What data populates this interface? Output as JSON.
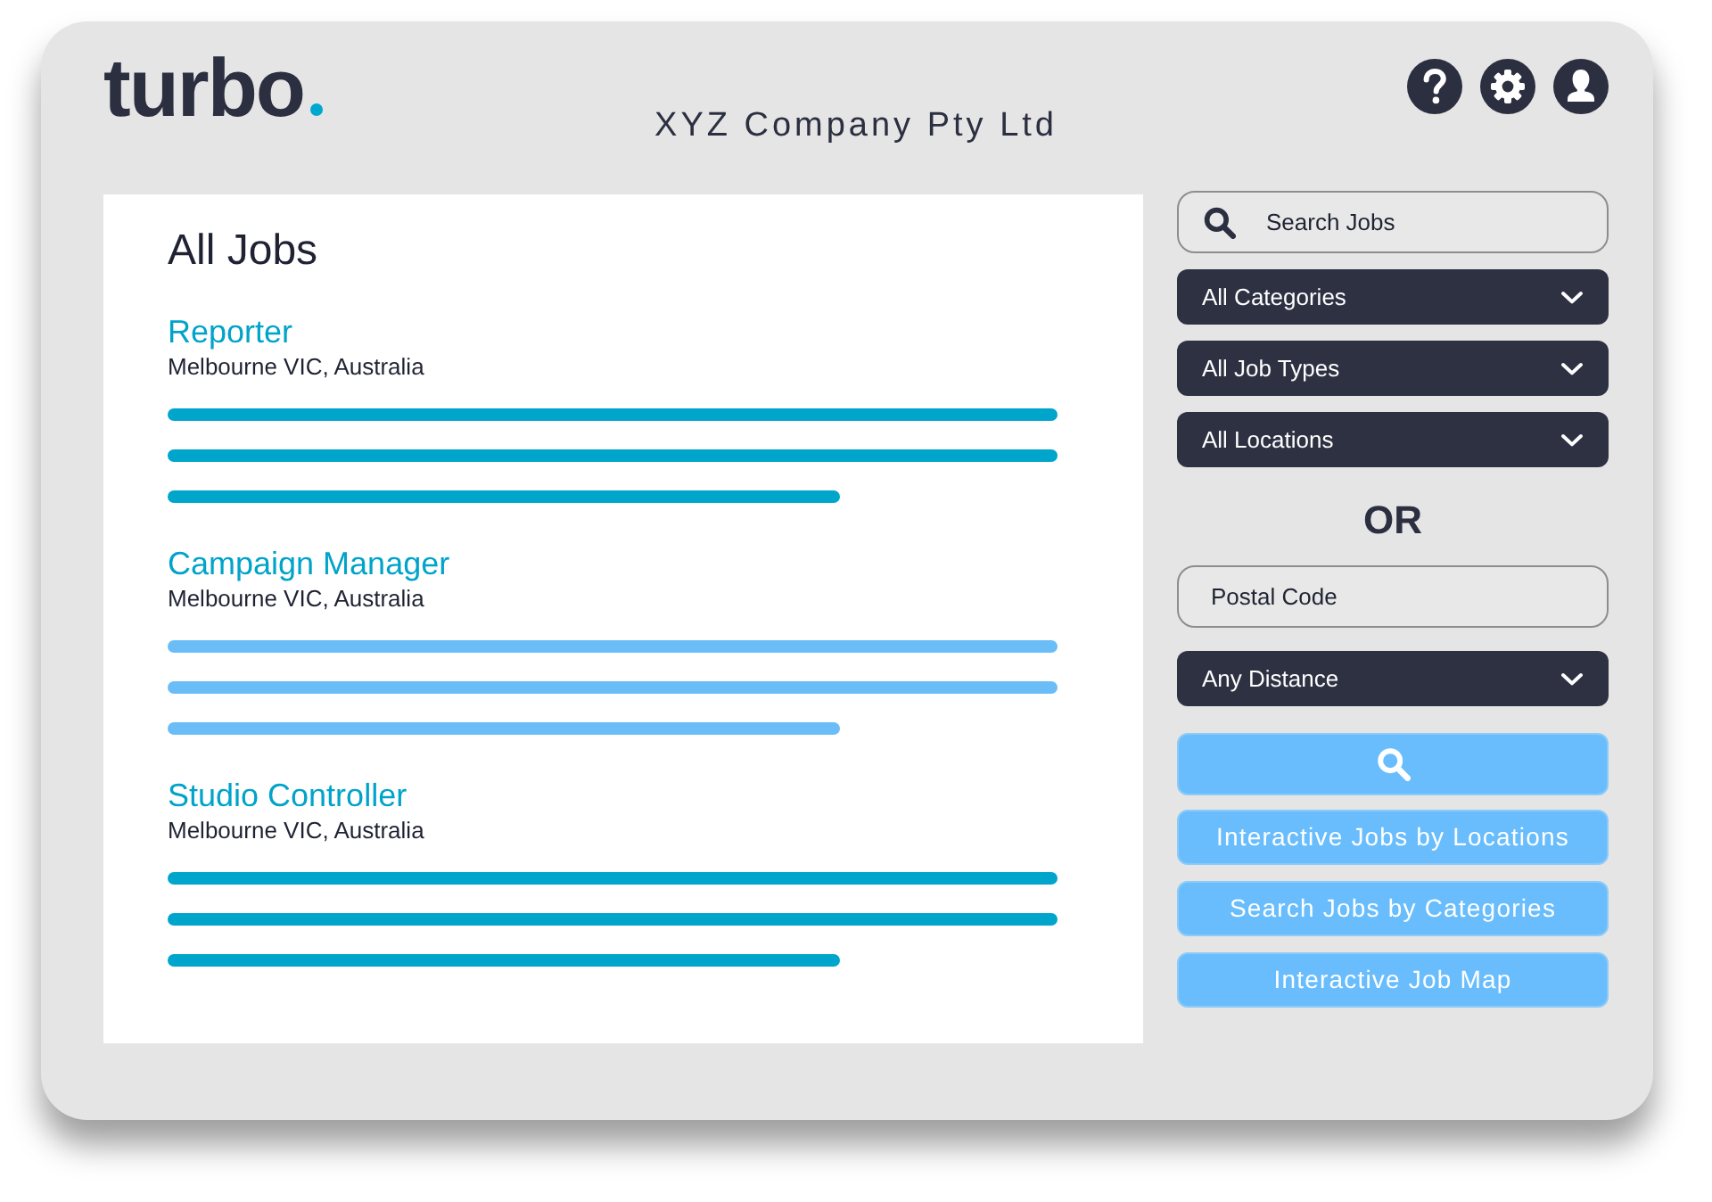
{
  "header": {
    "logo": "turbo",
    "company": "XYZ Company Pty Ltd"
  },
  "jobs_panel": {
    "title": "All Jobs",
    "jobs": [
      {
        "title": "Reporter",
        "location": "Melbourne VIC, Australia",
        "color": "#00a5cc"
      },
      {
        "title": "Campaign Manager",
        "location": "Melbourne VIC, Australia",
        "color": "#6bbdf7"
      },
      {
        "title": "Studio Controller",
        "location": "Melbourne VIC, Australia",
        "color": "#00a5cc"
      }
    ]
  },
  "filters": {
    "search": {
      "placeholder": "Search Jobs"
    },
    "dropdowns": [
      {
        "value": "All Categories"
      },
      {
        "value": "All Job Types"
      },
      {
        "value": "All Locations"
      }
    ],
    "separator": "OR",
    "postal_code": {
      "placeholder": "Postal Code"
    },
    "distance": {
      "value": "Any Distance"
    },
    "links": [
      "Interactive Jobs by Locations",
      "Search Jobs by Categories",
      "Interactive Job Map"
    ]
  }
}
